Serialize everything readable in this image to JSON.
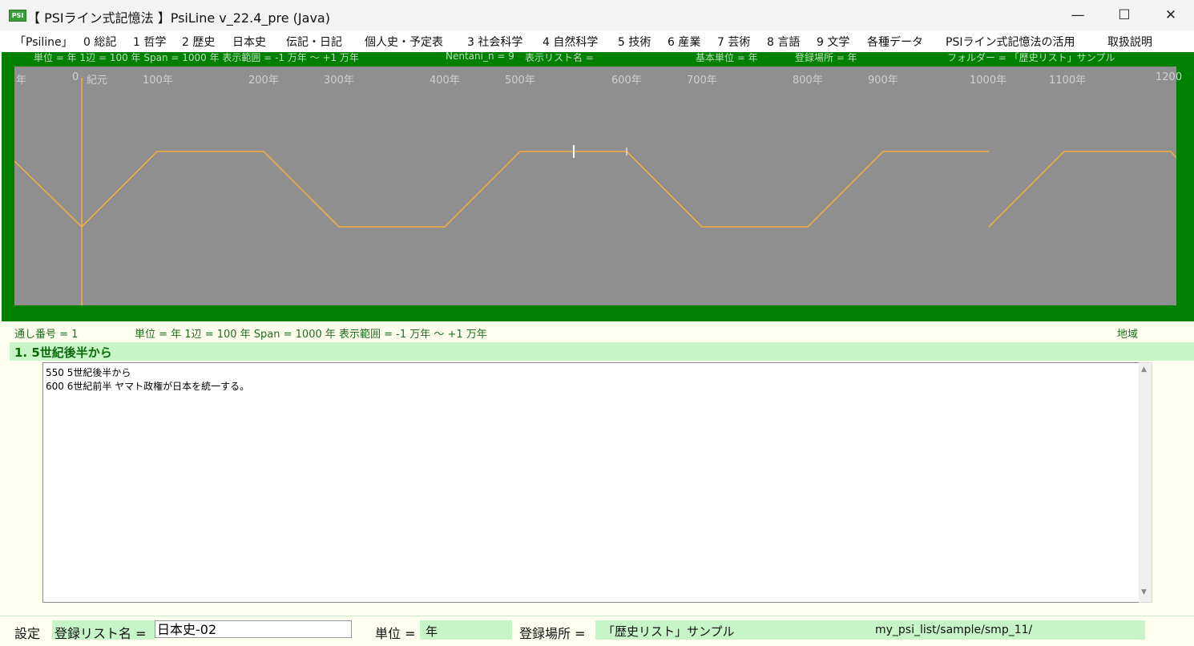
{
  "window": {
    "icon_text": "PSI",
    "title": "【 PSIライン式記憶法 】PsiLine v_22.4_pre (Java)",
    "minimize": "—",
    "maximize": "☐",
    "close": "✕"
  },
  "menu": [
    "「Psiline」",
    "0 総記",
    "1 哲学",
    "2 歴史",
    "日本史",
    "伝記・日記",
    "個人史・予定表",
    "3 社会科学",
    "4 自然科学",
    "5 技術",
    "6 産業",
    "7 芸術",
    "8 言語",
    "9 文学",
    "各種データ",
    "PSIライン式記憶法の活用",
    "取扱説明"
  ],
  "info_strip": {
    "units": "単位 = 年  1辺 = 100 年  Span = 1000 年  表示範囲 = -1 万年 〜 +1 万年",
    "nentani": "Nentani_n = 9",
    "list_name": "表示リスト名 =",
    "base_unit": "基本単位 = 年",
    "reg_place": "登録場所 = 年",
    "folder": "フォルダー = 「歴史リスト」サンプル"
  },
  "chart": {
    "year_labels": [
      "年",
      "0",
      "紀元",
      "100年",
      "200年",
      "300年",
      "400年",
      "500年",
      "600年",
      "700年",
      "800年",
      "900年",
      "1000年",
      "1100年",
      "1200"
    ],
    "line_color": "#f0b040",
    "cursor_color": "#ffffff"
  },
  "status": {
    "serial": "通し番号 = 1",
    "units": "単位 = 年  1辺 = 100 年  Span = 1000 年  表示範囲 = -1 万年 〜 +1 万年",
    "region": "地域"
  },
  "heading": "1. 5世紀後半から",
  "entries": [
    "550  5世紀後半から",
    "600  6世紀前半 ヤマト政権が日本を統一する。"
  ],
  "bottom": {
    "settings": "設定",
    "list_label": "登録リスト名 =",
    "list_value": "日本史-02",
    "unit_label": "単位 =",
    "unit_value": "年",
    "place_label": "登録場所 =",
    "place_value": "「歴史リスト」サンプル",
    "path": "my_psi_list/sample/smp_11/"
  }
}
